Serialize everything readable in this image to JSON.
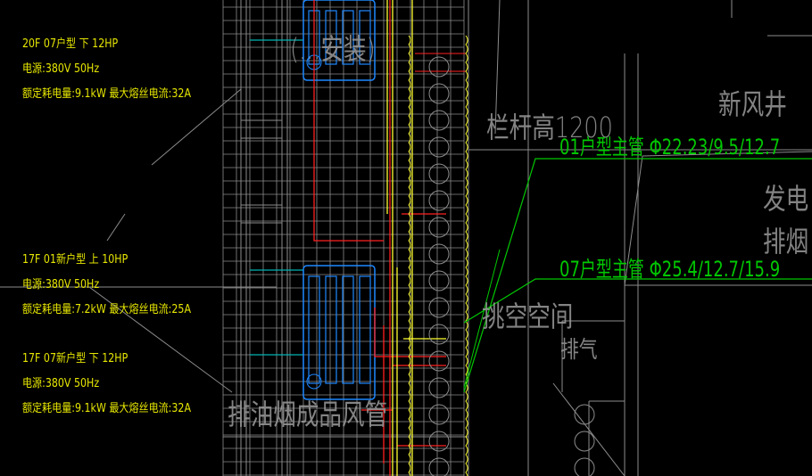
{
  "colors": {
    "background": "#000000",
    "grid": "#8c8c8c",
    "duct": "#1e88ff",
    "pipe_liquid": "#ff2020",
    "pipe_gas": "#ffff30",
    "leader": "#00c800",
    "wire": "#00b4b4",
    "annotation": "#e6e600"
  },
  "units": [
    {
      "title": "20F 07户型 下 12HP",
      "power": "电源:380V 50Hz",
      "rating": "额定耗电量:9.1kW 最大熔丝电流:32A"
    },
    {
      "title": "17F 01新户型 上 10HP",
      "power": "电源:380V 50Hz",
      "rating": "额定耗电量:7.2kW 最大熔丝电流:25A"
    },
    {
      "title": "17F 07新户型 下 12HP",
      "power": "电源:380V 50Hz",
      "rating": "额定耗电量:9.1kW 最大熔丝电流:32A"
    }
  ],
  "pipes": [
    {
      "label": "01户型主管 Φ22.23/9.5/12.7"
    },
    {
      "label": "07户型主管 Φ25.4/12.7/15.9"
    }
  ],
  "room_labels": {
    "railing": "栏杆高1200",
    "fresh_air_shaft": "新风井",
    "generator": "发电",
    "smoke_exhaust": "排烟",
    "void_space": "挑空空间",
    "exhaust": "排气",
    "kitchen_duct": "排油烟成品风管",
    "install_note": "(...安装)"
  }
}
